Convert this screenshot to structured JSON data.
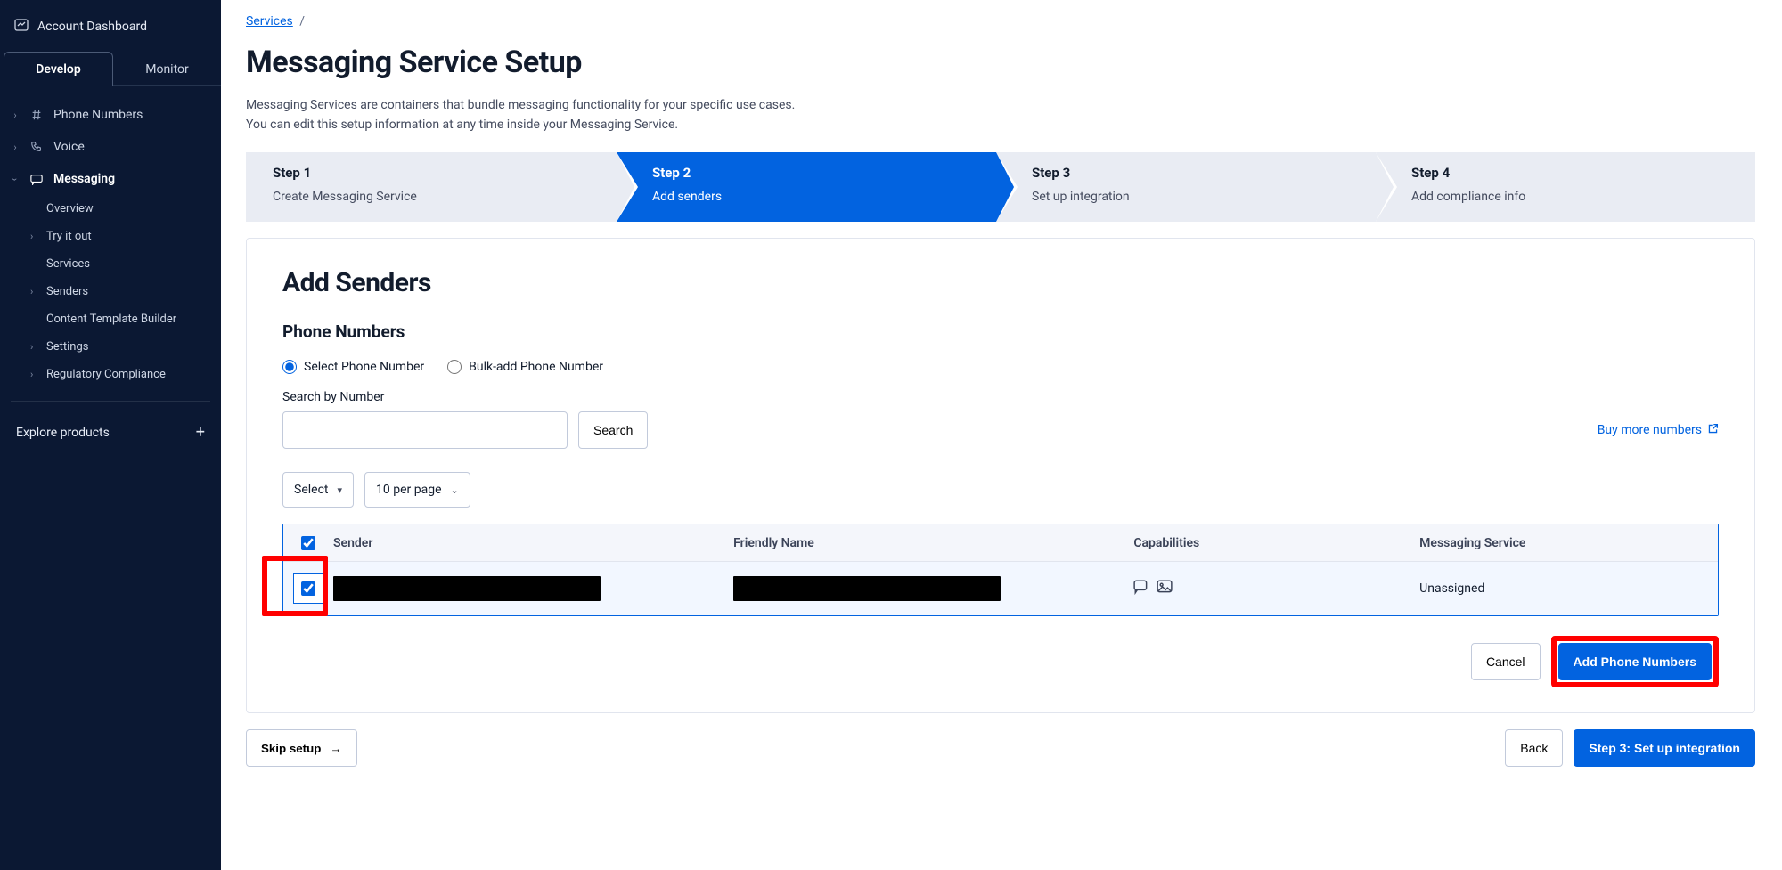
{
  "sidebar": {
    "account_dashboard": "Account Dashboard",
    "tabs": {
      "develop": "Develop",
      "monitor": "Monitor"
    },
    "items": {
      "phone_numbers": "Phone Numbers",
      "voice": "Voice",
      "messaging": "Messaging"
    },
    "messaging_children": {
      "overview": "Overview",
      "try_it_out": "Try it out",
      "services": "Services",
      "senders": "Senders",
      "content_template_builder": "Content Template Builder",
      "settings": "Settings",
      "regulatory_compliance": "Regulatory Compliance"
    },
    "explore": "Explore products"
  },
  "breadcrumb": {
    "services": "Services",
    "sep": "/"
  },
  "page": {
    "title": "Messaging Service Setup",
    "desc1": "Messaging Services are containers that bundle messaging functionality for your specific use cases.",
    "desc2": "You can edit this setup information at any time inside your Messaging Service."
  },
  "stepper": {
    "s1_label": "Step 1",
    "s1_text": "Create Messaging Service",
    "s2_label": "Step 2",
    "s2_text": "Add senders",
    "s3_label": "Step 3",
    "s3_text": "Set up integration",
    "s4_label": "Step 4",
    "s4_text": "Add compliance info"
  },
  "card": {
    "title": "Add Senders",
    "subtitle": "Phone Numbers",
    "radio_select": "Select Phone Number",
    "radio_bulk": "Bulk-add Phone Number",
    "search_label": "Search by Number",
    "search_btn": "Search",
    "buy_more": "Buy more numbers",
    "dd_select": "Select",
    "dd_per_page": "10 per page"
  },
  "table": {
    "col_sender": "Sender",
    "col_friendly": "Friendly Name",
    "col_caps": "Capabilities",
    "col_service": "Messaging Service",
    "row1_service": "Unassigned"
  },
  "actions": {
    "cancel": "Cancel",
    "add_numbers": "Add Phone Numbers"
  },
  "footer": {
    "skip": "Skip setup",
    "back": "Back",
    "next": "Step 3: Set up integration"
  }
}
